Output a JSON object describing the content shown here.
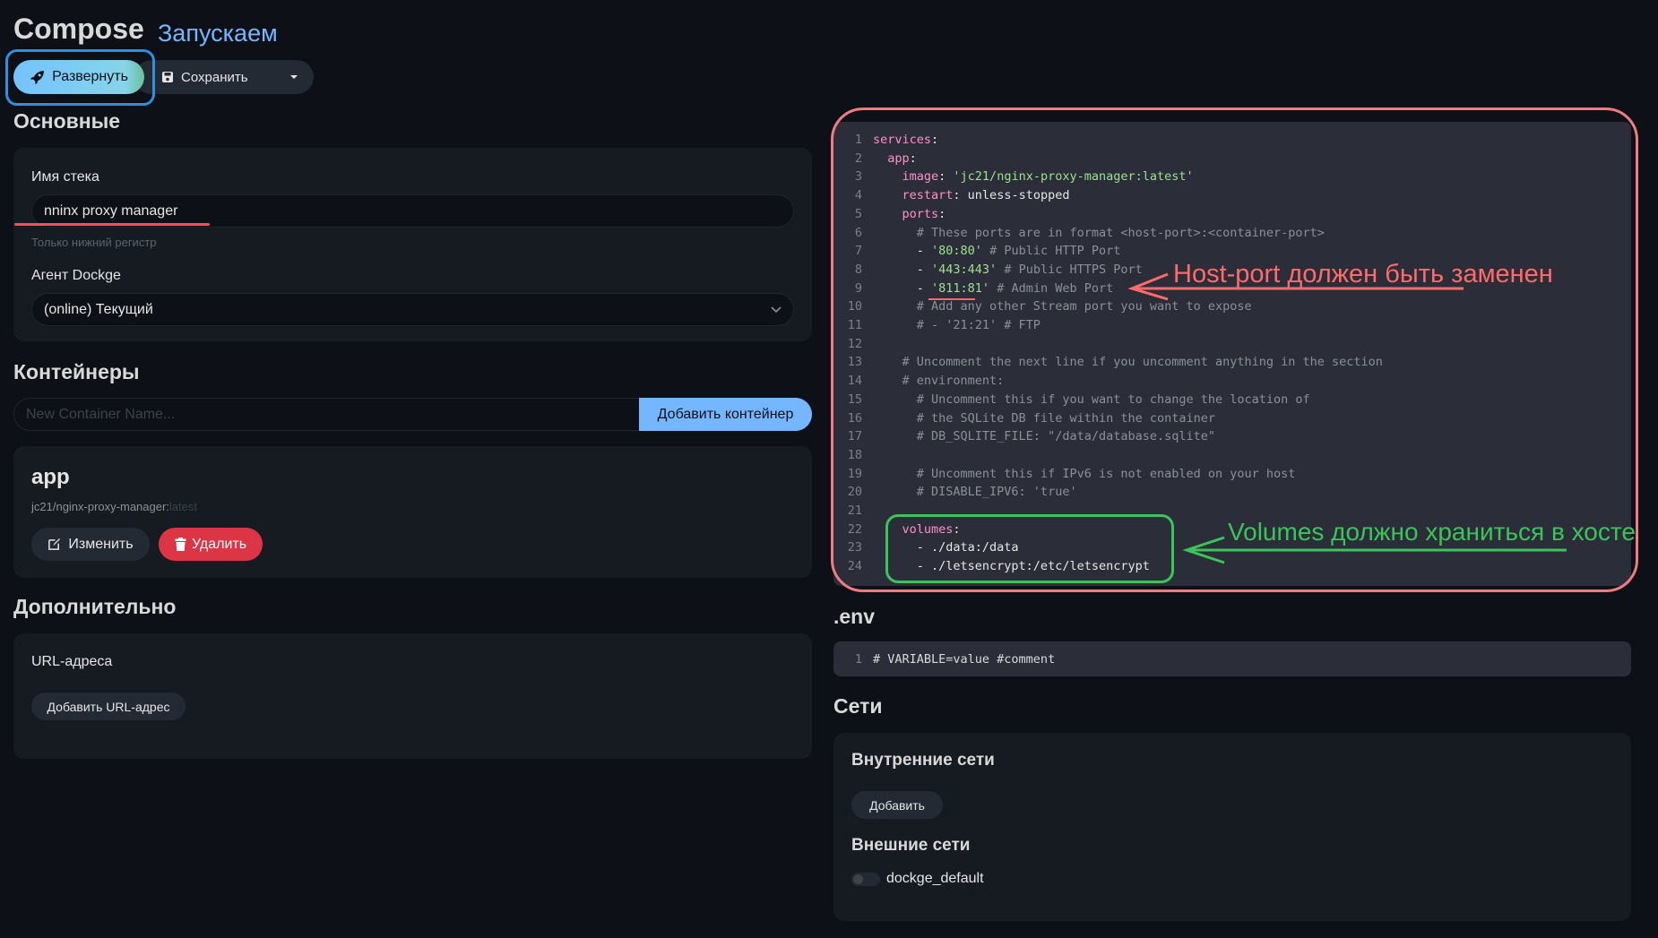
{
  "header": {
    "title": "Compose",
    "subtitle": "Запускаем"
  },
  "toolbar": {
    "deploy_label": "Развернуть",
    "save_label": "Сохранить"
  },
  "general": {
    "title": "Основные",
    "stack_name_label": "Имя стека",
    "stack_name_value": "nninx proxy manager",
    "stack_name_hint": "Только нижний регистр",
    "agent_label": "Агент Dockge",
    "agent_value": "(online) Текущий"
  },
  "containers": {
    "title": "Контейнеры",
    "new_placeholder": "New Container Name...",
    "add_button": "Добавить контейнер",
    "items": [
      {
        "name": "app",
        "image": "jc21/nginx-proxy-manager:",
        "tag": "latest",
        "edit_label": "Изменить",
        "delete_label": "Удалить"
      }
    ]
  },
  "additional": {
    "title": "Дополнительно",
    "urls_label": "URL-адреса",
    "add_url_button": "Добавить URL-адрес"
  },
  "compose_lines": [
    [
      [
        "k",
        "services"
      ],
      [
        "v",
        ":"
      ]
    ],
    [
      [
        "v",
        "  "
      ],
      [
        "k",
        "app"
      ],
      [
        "v",
        ":"
      ]
    ],
    [
      [
        "v",
        "    "
      ],
      [
        "k",
        "image"
      ],
      [
        "v",
        ": "
      ],
      [
        "s",
        "'jc21/nginx-proxy-manager:latest'"
      ]
    ],
    [
      [
        "v",
        "    "
      ],
      [
        "k",
        "restart"
      ],
      [
        "v",
        ": unless-stopped"
      ]
    ],
    [
      [
        "v",
        "    "
      ],
      [
        "k",
        "ports"
      ],
      [
        "v",
        ":"
      ]
    ],
    [
      [
        "c",
        "      # These ports are in format <host-port>:<container-port>"
      ]
    ],
    [
      [
        "v",
        "      - "
      ],
      [
        "s",
        "'80:80'"
      ],
      [
        "c",
        " # Public HTTP Port"
      ]
    ],
    [
      [
        "v",
        "      - "
      ],
      [
        "s",
        "'443:443'"
      ],
      [
        "c",
        " # Public HTTPS Port"
      ]
    ],
    [
      [
        "v",
        "      - "
      ],
      [
        "s",
        "'811:81'"
      ],
      [
        "c",
        " # Admin Web Port"
      ]
    ],
    [
      [
        "c",
        "      # Add any other Stream port you want to expose"
      ]
    ],
    [
      [
        "c",
        "      # - '21:21' # FTP"
      ]
    ],
    [
      [
        "v",
        ""
      ]
    ],
    [
      [
        "c",
        "    # Uncomment the next line if you uncomment anything in the section"
      ]
    ],
    [
      [
        "c",
        "    # environment:"
      ]
    ],
    [
      [
        "c",
        "      # Uncomment this if you want to change the location of"
      ]
    ],
    [
      [
        "c",
        "      # the SQLite DB file within the container"
      ]
    ],
    [
      [
        "c",
        "      # DB_SQLITE_FILE: \"/data/database.sqlite\""
      ]
    ],
    [
      [
        "v",
        ""
      ]
    ],
    [
      [
        "c",
        "      # Uncomment this if IPv6 is not enabled on your host"
      ]
    ],
    [
      [
        "c",
        "      # DISABLE_IPV6: 'true'"
      ]
    ],
    [
      [
        "v",
        ""
      ]
    ],
    [
      [
        "v",
        "    "
      ],
      [
        "k",
        "volumes"
      ],
      [
        "v",
        ":"
      ]
    ],
    [
      [
        "v",
        "      - ./data:/data"
      ]
    ],
    [
      [
        "v",
        "      - ./letsencrypt:/etc/letsencrypt"
      ]
    ]
  ],
  "env": {
    "title": ".env",
    "line": "# VARIABLE=value #comment"
  },
  "networks": {
    "title": "Сети",
    "internal_label": "Внутренние сети",
    "add_label": "Добавить",
    "external_label": "Внешние сети",
    "external_items": [
      "dockge_default"
    ]
  },
  "annotations": {
    "host_port": "Host-port должен быть заменен",
    "volumes": "Volumes должно храниться в хосте"
  },
  "colors": {
    "background": "#0d1117",
    "card": "#161b22",
    "accent_blue": "#74b6ff",
    "danger": "#dc3545",
    "annotation_red": "#ff6b6b",
    "annotation_green": "#3bc45a",
    "yaml_key": "#ff8fcb",
    "yaml_string": "#9fe08f"
  }
}
